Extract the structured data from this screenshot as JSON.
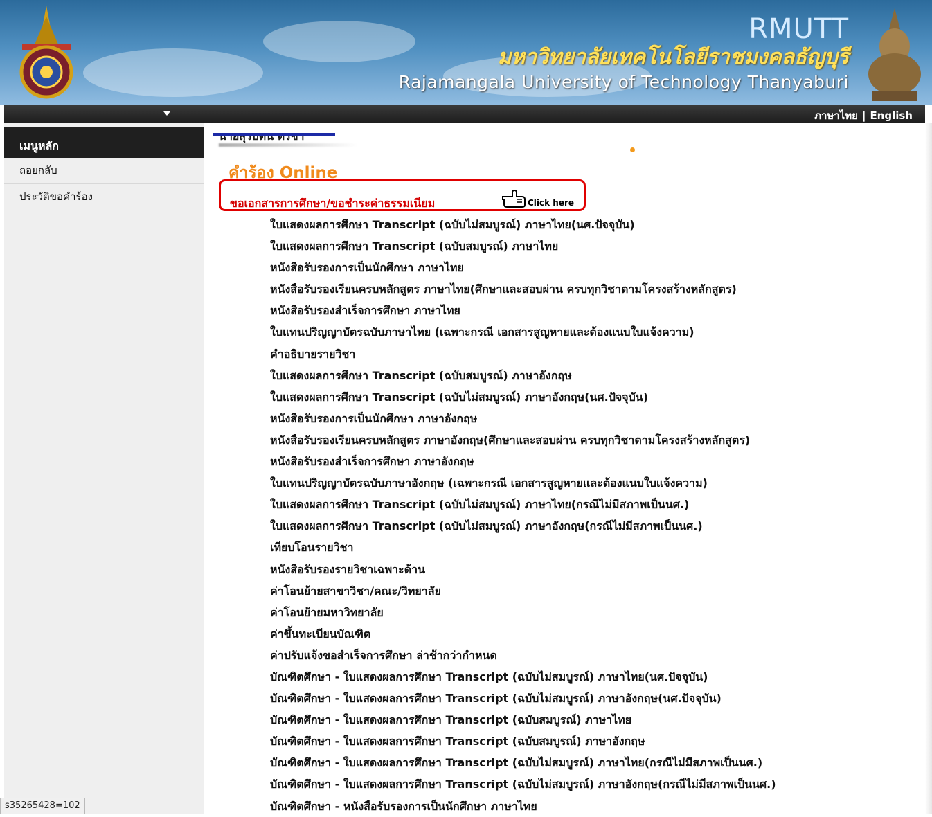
{
  "header": {
    "abbr": "RMUTT",
    "thai_name": "มหาวิทยาลัยเทคโนโลยีราชมงคลธัญบุรี",
    "english_name": "Rajamangala University of Technology Thanyaburi"
  },
  "nav": {
    "lang_thai": "ภาษาไทย",
    "separator": "|",
    "lang_english": "English"
  },
  "sidebar": {
    "title": "เมนูหลัก",
    "items": [
      {
        "label": "ถอยกลับ"
      },
      {
        "label": "ประวัติขอคำร้อง"
      }
    ]
  },
  "status_tip": "s35265428=102",
  "main": {
    "user_name": "นายสุรบิดน ตรีช่า",
    "title": "คำร้อง Online",
    "request_link": "ขอเอกสารการศึกษา/ขอชำระค่าธรรมเนียม",
    "click_here": "Click here",
    "documents": [
      "ใบแสดงผลการศึกษา Transcript (ฉบับไม่สมบูรณ์) ภาษาไทย(นศ.ปัจจุบัน)",
      "ใบแสดงผลการศึกษา Transcript (ฉบับสมบูรณ์) ภาษาไทย",
      "หนังสือรับรองการเป็นนักศึกษา ภาษาไทย",
      "หนังสือรับรองเรียนครบหลักสูตร ภาษาไทย(ศึกษาและสอบผ่าน ครบทุกวิชาตามโครงสร้างหลักสูตร)",
      "หนังสือรับรองสำเร็จการศึกษา ภาษาไทย",
      "ใบแทนปริญญาบัตรฉบับภาษาไทย (เฉพาะกรณี เอกสารสูญหายและต้องแนบใบแจ้งความ)",
      "คำอธิบายรายวิชา",
      "ใบแสดงผลการศึกษา Transcript (ฉบับสมบูรณ์) ภาษาอังกฤษ",
      "ใบแสดงผลการศึกษา Transcript (ฉบับไม่สมบูรณ์) ภาษาอังกฤษ(นศ.ปัจจุบัน)",
      "หนังสือรับรองการเป็นนักศึกษา ภาษาอังกฤษ",
      "หนังสือรับรองเรียนครบหลักสูตร ภาษาอังกฤษ(ศึกษาและสอบผ่าน ครบทุกวิชาตามโครงสร้างหลักสูตร)",
      "หนังสือรับรองสำเร็จการศึกษา ภาษาอังกฤษ",
      "ใบแทนปริญญาบัตรฉบับภาษาอังกฤษ (เฉพาะกรณี เอกสารสูญหายและต้องแนบใบแจ้งความ)",
      "ใบแสดงผลการศึกษา Transcript (ฉบับไม่สมบูรณ์) ภาษาไทย(กรณีไม่มีสภาพเป็นนศ.)",
      "ใบแสดงผลการศึกษา Transcript (ฉบับไม่สมบูรณ์) ภาษาอังกฤษ(กรณีไม่มีสภาพเป็นนศ.)",
      "เทียบโอนรายวิชา",
      "หนังสือรับรองรายวิชาเฉพาะด้าน",
      "ค่าโอนย้ายสาขาวิชา/คณะ/วิทยาลัย",
      "ค่าโอนย้ายมหาวิทยาลัย",
      "ค่าขึ้นทะเบียนบัณฑิต",
      "ค่าปรับแจ้งขอสำเร็จการศึกษา ล่าช้ากว่ากำหนด",
      "บัณฑิตศึกษา - ใบแสดงผลการศึกษา Transcript (ฉบับไม่สมบูรณ์) ภาษาไทย(นศ.ปัจจุบัน)",
      "บัณฑิตศึกษา - ใบแสดงผลการศึกษา Transcript (ฉบับไม่สมบูรณ์) ภาษาอังกฤษ(นศ.ปัจจุบัน)",
      "บัณฑิตศึกษา - ใบแสดงผลการศึกษา Transcript (ฉบับสมบูรณ์) ภาษาไทย",
      "บัณฑิตศึกษา - ใบแสดงผลการศึกษา Transcript (ฉบับสมบูรณ์) ภาษาอังกฤษ",
      "บัณฑิตศึกษา - ใบแสดงผลการศึกษา Transcript (ฉบับไม่สมบูรณ์) ภาษาไทย(กรณีไม่มีสภาพเป็นนศ.)",
      "บัณฑิตศึกษา - ใบแสดงผลการศึกษา Transcript (ฉบับไม่สมบูรณ์) ภาษาอังกฤษ(กรณีไม่มีสภาพเป็นนศ.)",
      "บัณฑิตศึกษา - หนังสือรับรองการเป็นนักศึกษา ภาษาไทย"
    ]
  },
  "colors": {
    "accent_orange": "#f08a1c",
    "link_red": "#d40000",
    "nav_dark": "#1d1d1d",
    "banner_blue": "#2c6b9c"
  }
}
